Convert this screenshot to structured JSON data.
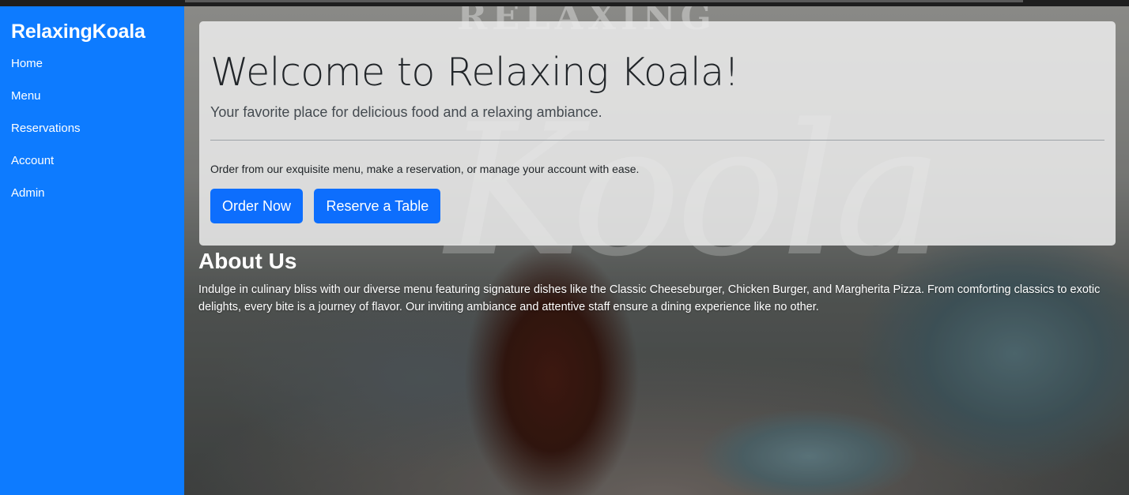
{
  "sidebar": {
    "brand": "RelaxingKoala",
    "items": [
      {
        "label": "Home"
      },
      {
        "label": "Menu"
      },
      {
        "label": "Reservations"
      },
      {
        "label": "Account"
      },
      {
        "label": "Admin"
      }
    ]
  },
  "background": {
    "sign_text": "RELAXING",
    "script_text": "Koola"
  },
  "hero": {
    "title": "Welcome to Relaxing Koala!",
    "lead": "Your favorite place for delicious food and a relaxing ambiance.",
    "text": "Order from our exquisite menu, make a reservation, or manage your account with ease.",
    "order_button": "Order Now",
    "reserve_button": "Reserve a Table"
  },
  "about": {
    "title": "About Us",
    "text": "Indulge in culinary bliss with our diverse menu featuring signature dishes like the Classic Cheeseburger, Chicken Burger, and Margherita Pizza. From comforting classics to exotic delights, every bite is a journey of flavor. Our inviting ambiance and attentive staff ensure a dining experience like no other."
  },
  "colors": {
    "sidebar": "#0d7bff",
    "primary_button": "#0d6efd"
  }
}
